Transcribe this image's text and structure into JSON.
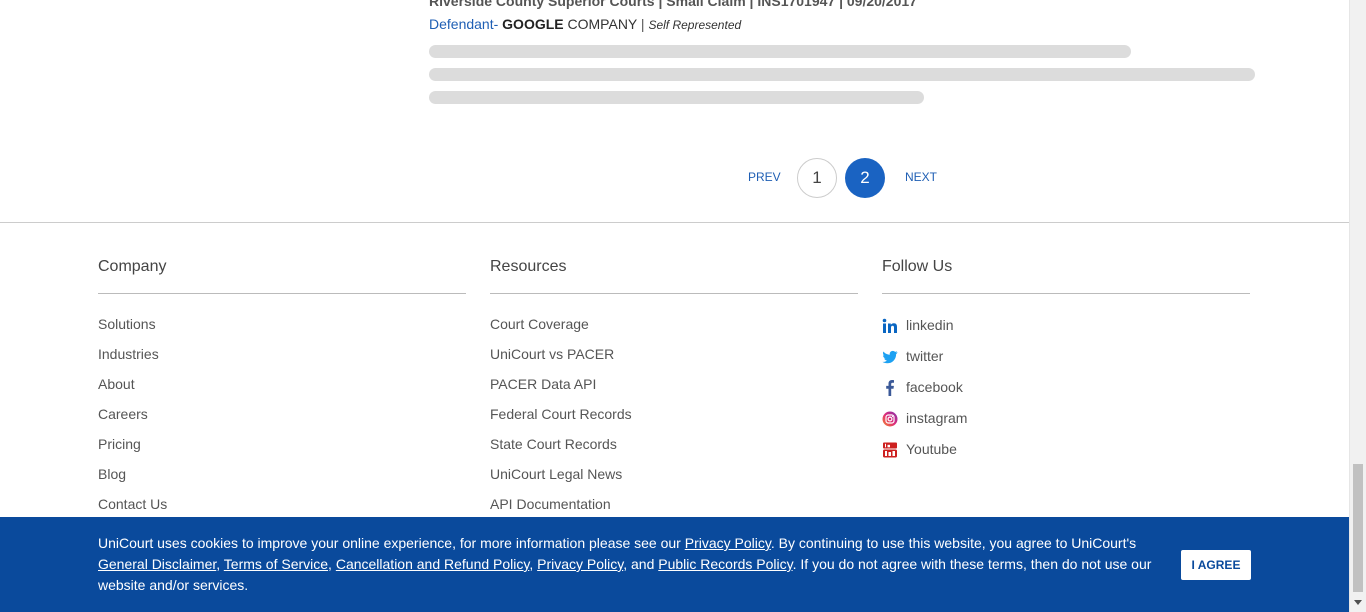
{
  "result": {
    "case_line": "Riverside County Superior Courts | Small Claim | INS1701947 | 09/20/2017",
    "role": "Defendant-",
    "party_bold": "GOOGLE",
    "party_rest": "COMPANY",
    "separator": "|",
    "representation": "Self Represented"
  },
  "pagination": {
    "prev_label": "PREV",
    "pages": [
      "1",
      "2"
    ],
    "current_page": "2",
    "next_label": "NEXT"
  },
  "footer": {
    "company": {
      "heading": "Company",
      "items": [
        "Solutions",
        "Industries",
        "About",
        "Careers",
        "Pricing",
        "Blog",
        "Contact Us"
      ]
    },
    "resources": {
      "heading": "Resources",
      "items": [
        "Court Coverage",
        "UniCourt vs PACER",
        "PACER Data API",
        "Federal Court Records",
        "State Court Records",
        "UniCourt Legal News",
        "API Documentation"
      ]
    },
    "follow": {
      "heading": "Follow Us",
      "items": [
        {
          "label": "linkedin",
          "icon": "linkedin-icon",
          "color": "#0a66c2"
        },
        {
          "label": "twitter",
          "icon": "twitter-icon",
          "color": "#1da1f2"
        },
        {
          "label": "facebook",
          "icon": "facebook-icon",
          "color": "#3b5998"
        },
        {
          "label": "instagram",
          "icon": "instagram-icon",
          "color": "#c13584"
        },
        {
          "label": "Youtube",
          "icon": "youtube-icon",
          "color": "#cd201f"
        }
      ]
    }
  },
  "cookie": {
    "text_1": "UniCourt uses cookies to improve your online experience, for more information please see our ",
    "link_privacy": "Privacy Policy",
    "text_2": ". By continuing to use this website, you agree to UniCourt's ",
    "link_disclaimer": "General Disclaimer",
    "text_3": ", ",
    "link_terms": "Terms of Service",
    "text_4": ", ",
    "link_refund": "Cancellation and Refund Policy",
    "text_5": ", ",
    "link_privacy_2": "Privacy Policy",
    "text_6": ", and ",
    "link_public": "Public Records Policy",
    "text_7": ". If you do not agree with these terms, then do not use our website and/or services.",
    "agree_label": "I AGREE"
  },
  "colors": {
    "accent": "#1a63c2",
    "cookie_bg": "#0a4a9c"
  }
}
